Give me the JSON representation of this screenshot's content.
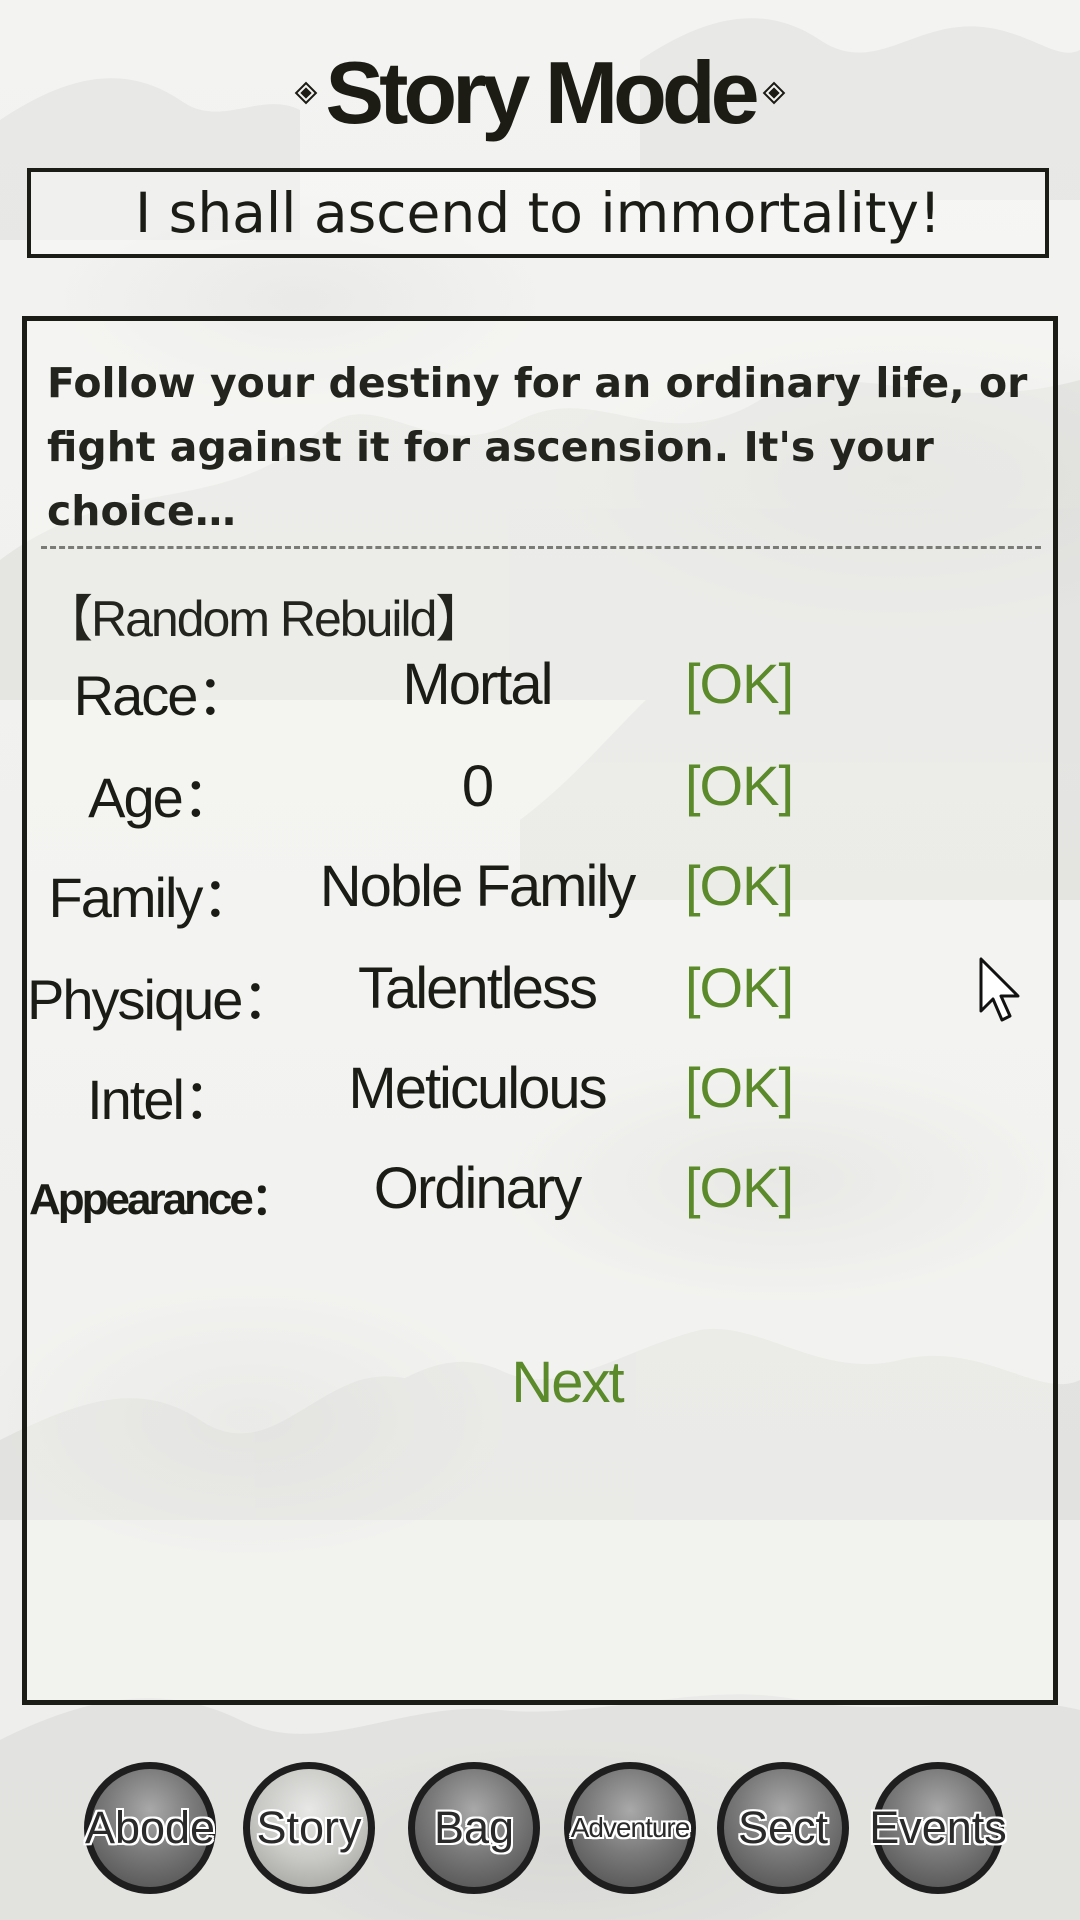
{
  "header": {
    "title": "Story Mode",
    "subtitle": "I shall ascend to immortality!"
  },
  "panel": {
    "intro": "Follow your destiny for an ordinary life, or fight against it for ascension. It's your choice…",
    "section_heading": "【Random Rebuild】",
    "attributes": [
      {
        "label": "Race：",
        "value": "Mortal",
        "action": "[OK]"
      },
      {
        "label": "Age：",
        "value": "0",
        "action": "[OK]"
      },
      {
        "label": "Family：",
        "value": "Noble Family",
        "action": "[OK]"
      },
      {
        "label": "Physique：",
        "value": "Talentless",
        "action": "[OK]"
      },
      {
        "label": "Intel：",
        "value": "Meticulous",
        "action": "[OK]"
      },
      {
        "label": "Appearance：",
        "value": "Ordinary",
        "action": "[OK]"
      }
    ],
    "next_label": "Next"
  },
  "nav": {
    "items": [
      {
        "label": "Abode",
        "active": false
      },
      {
        "label": "Story",
        "active": true
      },
      {
        "label": "Bag",
        "active": false
      },
      {
        "label": "Adventure",
        "active": false
      },
      {
        "label": "Sect",
        "active": false
      },
      {
        "label": "Events",
        "active": false
      }
    ]
  },
  "colors": {
    "accent_green": "#5b8a2a",
    "ink": "#1c1c16",
    "background": "#f0f0ee"
  },
  "icons": {
    "title_ornament": "diamond-ornament-icon",
    "pointer": "mouse-cursor-icon"
  }
}
